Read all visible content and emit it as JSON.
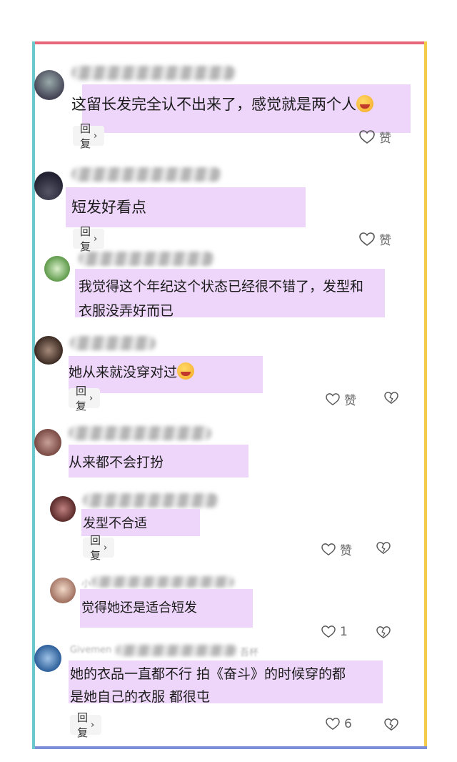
{
  "colors": {
    "frame_top": "#e8667a",
    "frame_right": "#f2cc4a",
    "frame_bottom": "#7b8fd8",
    "frame_left": "#6cc7cc",
    "highlight": "#eed6fb"
  },
  "comments": [
    {
      "text_lines": [
        "这留长发完全认不出来了，感觉就是两个人"
      ],
      "emoji": "laughing-crying-emoji",
      "reply_label": "回复",
      "like_label": "赞"
    },
    {
      "text_lines": [
        "短发好看点"
      ],
      "reply_label": "回复",
      "like_label": "赞"
    },
    {
      "text_lines": [
        "我觉得这个年纪这个状态已经很不错了，发型和",
        "衣服没弄好而已"
      ]
    },
    {
      "text_lines": [
        "她从来就没穿对过"
      ],
      "emoji": "laughing-crying-emoji",
      "reply_label": "回复",
      "like_label": "赞"
    },
    {
      "text_lines": [
        "从来都不会打扮"
      ]
    },
    {
      "text_lines": [
        "发型不合适"
      ],
      "reply_label": "回复",
      "like_label": "赞"
    },
    {
      "username_fragment": "小",
      "text_lines": [
        "觉得她还是适合短发"
      ],
      "like_count": "1"
    },
    {
      "username_fragment": "Givemen",
      "username_tail": "吾杯",
      "text_lines": [
        "她的衣品一直都不行 拍《奋斗》的时候穿的都",
        "是她自己的衣服 都很屯"
      ],
      "reply_label": "回复",
      "like_count": "6"
    }
  ],
  "icons": {
    "like": "heart-outline-icon",
    "dislike": "broken-heart-icon",
    "chevron": "chevron-right-icon"
  }
}
